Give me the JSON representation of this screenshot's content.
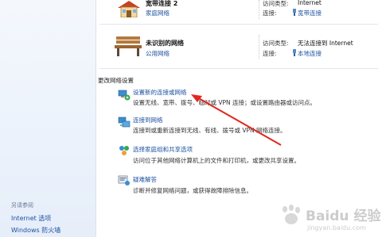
{
  "sidebar": {
    "see_also": "另请参阅",
    "links": [
      "Internet 选项",
      "Windows 防火墙"
    ]
  },
  "networks": [
    {
      "name": "宽带连接  2",
      "category": "家庭网络",
      "access_type_label": "访问类型:",
      "access_type_value": "Internet",
      "connection_label": "连接:",
      "connection_value": "宽带连接"
    },
    {
      "name": "未识别的网络",
      "category": "公用网络",
      "access_type_label": "访问类型:",
      "access_type_value": "无法连接到 Internet",
      "connection_label": "连接:",
      "connection_value": "本地连接"
    }
  ],
  "change_settings": {
    "heading": "更改网络设置",
    "items": [
      {
        "title": "设置新的连接或网络",
        "desc": "设置无线、宽带、拨号、临时或 VPN 连接；或设置路由器或访问点。",
        "icon": "network-setup-icon"
      },
      {
        "title": "连接到网络",
        "desc": "连接到或重新连接到无线、有线、拨号或 VPN 网络连接。",
        "icon": "connect-network-icon"
      },
      {
        "title": "选择家庭组和共享选项",
        "desc": "访问位于其他网络计算机上的文件和打印机，或更改共享设置。",
        "icon": "homegroup-icon"
      },
      {
        "title": "疑难解答",
        "desc": "诊断并修复网络问题，或获得故障排除信息。",
        "icon": "troubleshoot-icon"
      }
    ]
  },
  "colors": {
    "link": "#1a4f9e",
    "arrow": "#e0271f",
    "sidebar_bg": "#eef3fb"
  },
  "watermark": {
    "text": "Baidu 经验",
    "sub": "jingyan.baidu.com"
  }
}
